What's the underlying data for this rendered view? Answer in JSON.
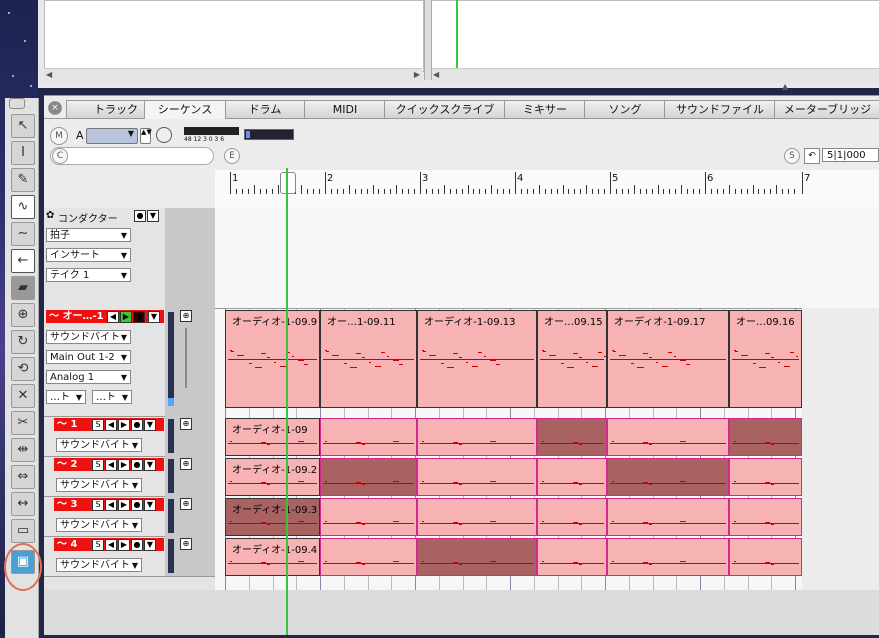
{
  "tabs": [
    {
      "label": "トラック"
    },
    {
      "label": "シーケンス"
    },
    {
      "label": "ドラム"
    },
    {
      "label": "MIDI"
    },
    {
      "label": "クイックスクライブ"
    },
    {
      "label": "ミキサー"
    },
    {
      "label": "ソング"
    },
    {
      "label": "サウンドファイル"
    },
    {
      "label": "メーターブリッジ"
    }
  ],
  "controls": {
    "m_label": "M",
    "a_label": "A",
    "c_label": "C",
    "e_label": "E",
    "s_label": "S",
    "meter_scale": "48 12 3 0 3 6",
    "position": "5|1|000"
  },
  "ruler": {
    "bars": [
      "1",
      "2",
      "3",
      "4",
      "5",
      "6",
      "7"
    ]
  },
  "conductor": {
    "label": "コンダクター",
    "dropdowns": [
      "拍子",
      "インサート",
      "テイク 1"
    ]
  },
  "main_track": {
    "name": "～ オー…-1",
    "dropdowns": [
      "サウンドバイト",
      "Main Out 1-2",
      "Analog 1"
    ],
    "small_dd": [
      "…ト",
      "…ト"
    ],
    "regions": [
      "オーディオ-1-09.9",
      "オー…1-09.11",
      "オーディオ-1-09.13",
      "オー…09.15",
      "オーディオ-1-09.17",
      "オー…09.16"
    ]
  },
  "sub_tracks": [
    {
      "name": "～ 1",
      "dd": "サウンドバイト",
      "region": "オーディオ-1-09"
    },
    {
      "name": "～ 2",
      "dd": "サウンドバイト",
      "region": "オーディオ-1-09.2"
    },
    {
      "name": "～ 3",
      "dd": "サウンドバイト",
      "region": "オーディオ-1-09.3"
    },
    {
      "name": "～ 4",
      "dd": "サウンドバイト",
      "region": "オーディオ-1-09.4"
    }
  ],
  "track_buttons": [
    "S",
    "◀",
    "▶",
    "●",
    "▼"
  ],
  "icons": [
    "pointer-icon",
    "ibeam-icon",
    "pencil-icon",
    "curve-icon",
    "wave-icon",
    "arrow-left-icon",
    "eraser-icon",
    "zoom-icon",
    "loop-icon",
    "rotate-icon",
    "x-icon",
    "scissors-icon",
    "stretch-icon",
    "split-icon",
    "fit-icon",
    "marquee-icon",
    "build-icon"
  ],
  "colors": {
    "accent_red": "#e11111",
    "region_pink": "#f7b3b3",
    "region_dark": "#a86262",
    "playhead": "#3cc23c"
  }
}
